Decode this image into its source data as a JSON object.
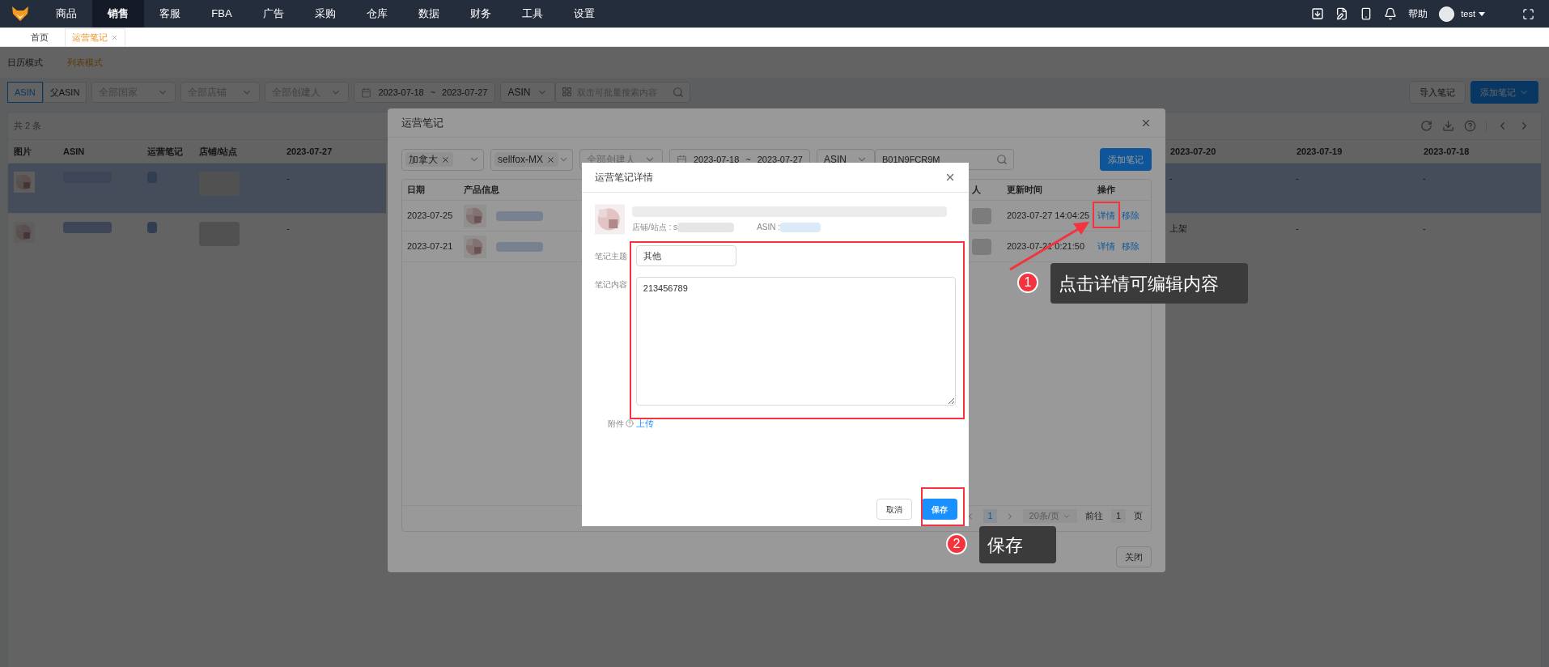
{
  "top_nav": {
    "items": [
      {
        "label": "商品",
        "selected": false
      },
      {
        "label": "销售",
        "selected": true
      },
      {
        "label": "客服",
        "selected": false
      },
      {
        "label": "FBA",
        "selected": false
      },
      {
        "label": "广告",
        "selected": false
      },
      {
        "label": "采购",
        "selected": false
      },
      {
        "label": "仓库",
        "selected": false
      },
      {
        "label": "数据",
        "selected": false
      },
      {
        "label": "财务",
        "selected": false
      },
      {
        "label": "工具",
        "selected": false
      },
      {
        "label": "设置",
        "selected": false
      }
    ],
    "help": "帮助",
    "user": "test"
  },
  "page_tabs": [
    {
      "label": "首页",
      "selected": false,
      "closable": false
    },
    {
      "label": "运营笔记",
      "selected": true,
      "closable": true
    }
  ],
  "view_modes": [
    {
      "label": "日历模式",
      "selected": false
    },
    {
      "label": "列表模式",
      "selected": true
    }
  ],
  "filters": {
    "asin_toggle": [
      {
        "label": "ASIN",
        "selected": true
      },
      {
        "label": "父ASIN",
        "selected": false
      }
    ],
    "country": "全部国家",
    "shop": "全部店铺",
    "creator": "全部创建人",
    "date_from": "2023-07-18",
    "date_sep": "~",
    "date_to": "2023-07-27",
    "search_type": "ASIN",
    "search_placeholder": "双击可批量搜索内容"
  },
  "actions": [
    "导入笔记",
    "添加笔记"
  ],
  "summary": "共 2 条",
  "table": {
    "columns": [
      "图片",
      "ASIN",
      "运营笔记",
      "店铺/站点",
      "2023-07-27",
      "2023-07-20",
      "2023-07-19",
      "2023-07-18"
    ],
    "rows": [
      {
        "selected": true,
        "cells": [
          "-",
          "-",
          "-",
          "-"
        ]
      },
      {
        "selected": false,
        "cells": [
          "-",
          "上架",
          "-",
          "-"
        ]
      }
    ]
  },
  "notes_dialog": {
    "title": "运营笔记",
    "filters": {
      "country_tag": "加拿大",
      "shop_tag": "sellfox-MX",
      "creator": "全部创建人",
      "date_from": "2023-07-18",
      "date_sep": "~",
      "date_to": "2023-07-27",
      "search_type": "ASIN",
      "search_value": "B01N9FCR9M"
    },
    "add_button": "添加笔记",
    "columns": [
      "日期",
      "产品信息",
      "人",
      "更新时间",
      "操作"
    ],
    "rows": [
      {
        "date": "2023-07-25",
        "updated": "2023-07-27 14:04:25",
        "actions": [
          "详情",
          "移除"
        ]
      },
      {
        "date": "2023-07-21",
        "updated": "2023-07-21 0:21:50",
        "actions": [
          "详情",
          "移除"
        ]
      }
    ],
    "pagination": {
      "page": "1",
      "page_size": "20条/页",
      "goto_label": "前往",
      "goto_value": "1",
      "pages_suffix": "页"
    },
    "close_button": "关闭"
  },
  "detail_dialog": {
    "title": "运营笔记详情",
    "shop_label": "店铺/站点 : s",
    "asin_label": "ASIN :",
    "subject_label": "笔记主题",
    "subject_value": "其他",
    "content_label": "笔记内容",
    "content_value": "213456789",
    "attachment_label": "附件",
    "upload_link": "上传",
    "cancel_button": "取消",
    "save_button": "保存"
  },
  "callouts": [
    {
      "number": "1",
      "text": "点击详情可编辑内容"
    },
    {
      "number": "2",
      "text": "保存"
    }
  ]
}
